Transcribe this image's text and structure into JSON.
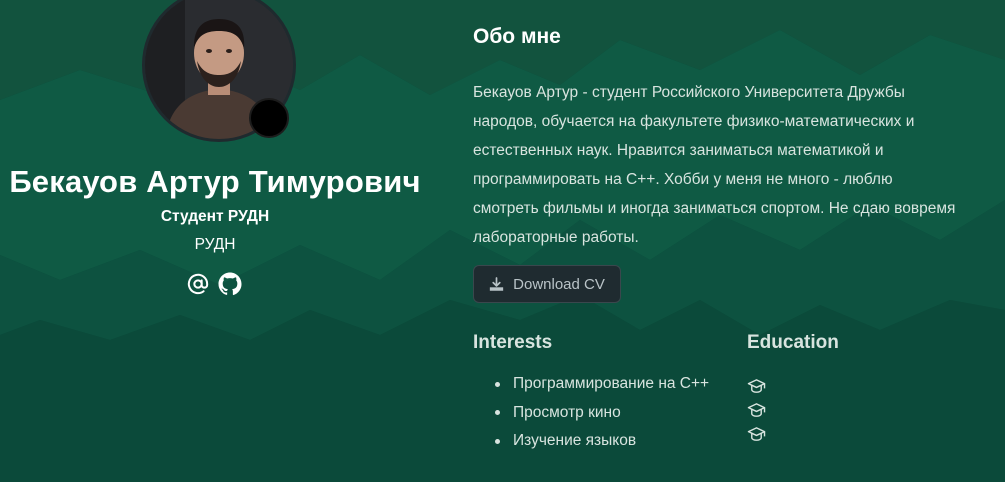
{
  "profile": {
    "name": "Бекауов Артур Тимурович",
    "role": "Студент РУДН",
    "organization": "РУДН",
    "avatar_icon": "profile-photo",
    "status_icon": "status-dot",
    "socials": [
      {
        "icon": "at-sign-icon"
      },
      {
        "icon": "github-icon"
      }
    ]
  },
  "about": {
    "title": "Обо мне",
    "lines": [
      "Бекауов Артур - студент Российского Университета Дружбы",
      "народов, обучается на факультете физико-математических и",
      "естественных наук. Нравится заниматься математикой и",
      "программировать на С++. Хобби у меня не много - люблю",
      "смотреть фильмы и иногда заниматься спортом. Не сдаю вовремя",
      "лабораторные работы."
    ],
    "download_label": "Download CV"
  },
  "interests": {
    "title": "Interests",
    "items": [
      "Программирование на С++",
      "Просмотр кино",
      "Изучение языков"
    ]
  },
  "education": {
    "title": "Education",
    "items": [
      {
        "icon": "graduation-cap-icon"
      },
      {
        "icon": "graduation-cap-icon"
      },
      {
        "icon": "graduation-cap-icon"
      }
    ]
  },
  "colors": {
    "background": "#0c4d3b",
    "text": "#ffffff",
    "muted_text": "#d8e4df",
    "button_bg": "#1f2b30"
  }
}
